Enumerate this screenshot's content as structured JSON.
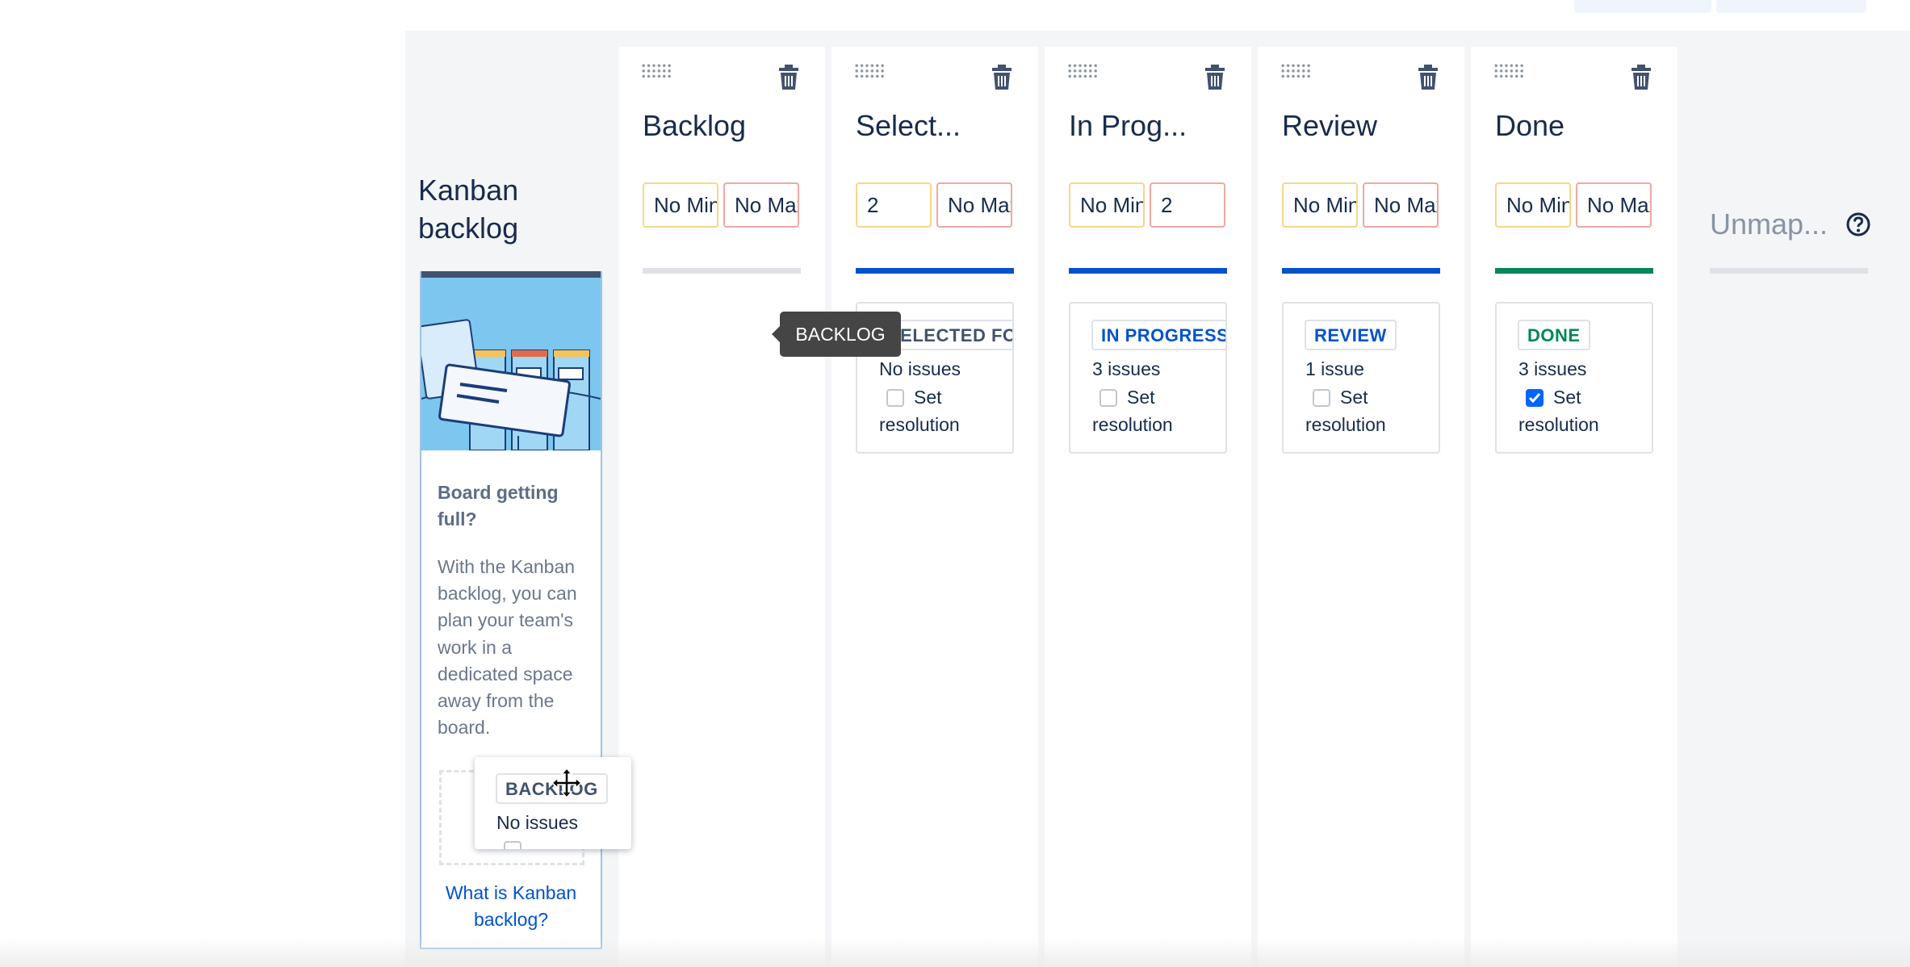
{
  "kanban_backlog": {
    "title": "Kanban backlog",
    "heading": "Board getting full?",
    "body": "With the Kanban backlog, you can plan your team's work in a dedicated space away from the board.",
    "link": "What is Kanban backlog?"
  },
  "columns": [
    {
      "name": "Backlog",
      "min": "No Min",
      "max": "No Max",
      "bar_color": "#dfe1e6"
    },
    {
      "name": "Select...",
      "min": "2",
      "max": "No Max",
      "bar_color": "#0052cc",
      "status": "SELECTED FOR DEVELOPMENT",
      "status_color": "#42526e",
      "count": "No issues",
      "set_label": "Set",
      "resolution_label": "resolution",
      "checked": false
    },
    {
      "name": "In Prog...",
      "min": "No Min",
      "max": "2",
      "bar_color": "#0052cc",
      "status": "IN PROGRESS",
      "status_color": "#0052cc",
      "count": "3 issues",
      "set_label": "Set",
      "resolution_label": "resolution",
      "checked": false
    },
    {
      "name": "Review",
      "min": "No Min",
      "max": "No Max",
      "bar_color": "#0052cc",
      "status": "REVIEW",
      "status_color": "#0052cc",
      "count": "1 issue",
      "set_label": "Set",
      "resolution_label": "resolution",
      "checked": false
    },
    {
      "name": "Done",
      "min": "No Min",
      "max": "No Max",
      "bar_color": "#00875a",
      "status": "DONE",
      "status_color": "#00875a",
      "count": "3 issues",
      "set_label": "Set",
      "resolution_label": "resolution",
      "checked": true
    }
  ],
  "tooltip": "BACKLOG",
  "dragged_card": {
    "status": "BACKLOG",
    "count": "No issues"
  },
  "unmapped": {
    "title": "Unmap..."
  },
  "icons": {
    "drag": "grip-icon",
    "delete": "trash-icon",
    "help": "help-icon",
    "move": "move-cursor-icon",
    "check": "checkmark-icon"
  }
}
